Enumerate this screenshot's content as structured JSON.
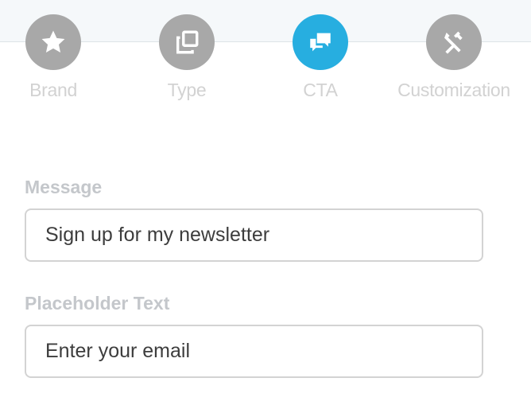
{
  "steps": [
    {
      "label": "Brand",
      "icon": "star-icon",
      "active": false
    },
    {
      "label": "Type",
      "icon": "copy-icon",
      "active": false
    },
    {
      "label": "CTA",
      "icon": "chat-bubbles-icon",
      "active": true
    },
    {
      "label": "Customization",
      "icon": "tools-icon",
      "active": false
    }
  ],
  "colors": {
    "step_inactive": "#a8a8a8",
    "step_active": "#27aee0",
    "label_text": "#c4c7cb"
  },
  "form": {
    "message": {
      "label": "Message",
      "value": "Sign up for my newsletter"
    },
    "placeholder_text": {
      "label": "Placeholder Text",
      "value": "Enter your email"
    }
  }
}
